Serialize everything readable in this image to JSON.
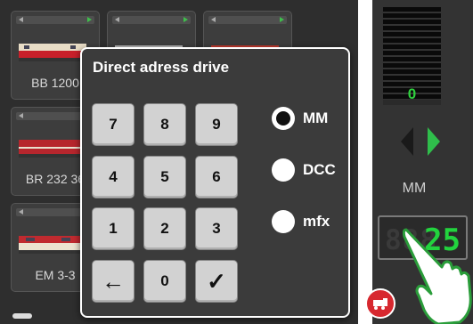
{
  "loco_grid": {
    "tiles": [
      {
        "name": "BB 1200"
      },
      {
        "name": ""
      },
      {
        "name": ""
      },
      {
        "name": "BR 232 36"
      },
      {
        "name": "EM 3-3"
      }
    ]
  },
  "dialog": {
    "title": "Direct adress drive",
    "keys": [
      "7",
      "8",
      "9",
      "4",
      "5",
      "6",
      "1",
      "2",
      "3",
      "←",
      "0",
      "✓"
    ],
    "protocols": [
      {
        "label": "MM",
        "selected": true
      },
      {
        "label": "DCC",
        "selected": false
      },
      {
        "label": "mfx",
        "selected": false
      }
    ]
  },
  "control": {
    "speed": "0",
    "protocol": "MM",
    "address_ghost": "888",
    "address": "25"
  },
  "colors": {
    "accent_green": "#2fd03e",
    "fab_red": "#d7282f"
  }
}
